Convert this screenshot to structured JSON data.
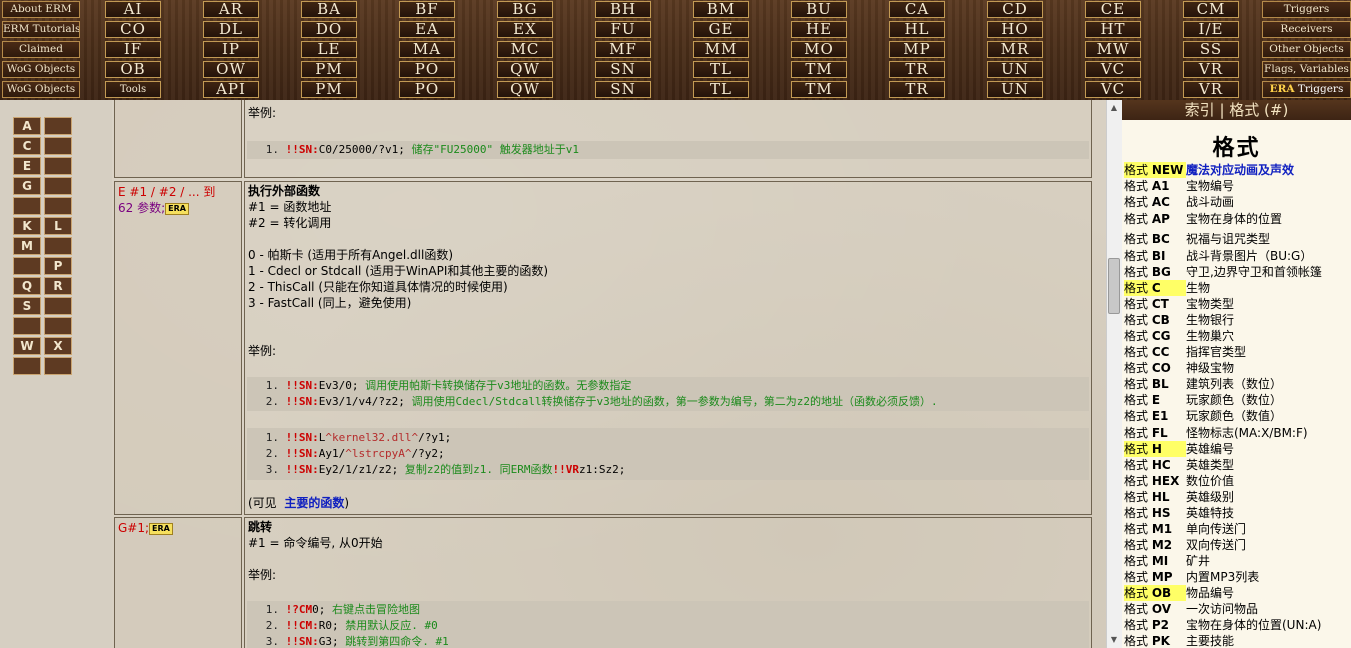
{
  "left_nav": [
    "About ERM",
    "ERM Tutorials",
    "Claimed",
    "WoG Objects",
    "WoG Objects"
  ],
  "right_nav": [
    "Triggers",
    "Receivers",
    "Other Objects",
    "Flags, Variables"
  ],
  "right_nav_era": {
    "prefix": "ERA",
    "label": "Triggers"
  },
  "grid_rows": [
    [
      "AI",
      "AR",
      "BA",
      "BF",
      "BG",
      "BH",
      "BM",
      "BU",
      "CA",
      "CD",
      "CE",
      "CM"
    ],
    [
      "CO",
      "DL",
      "DO",
      "EA",
      "EX",
      "FU",
      "GE",
      "HE",
      "HL",
      "HO",
      "HT",
      "I/E"
    ],
    [
      "IF",
      "IP",
      "LE",
      "MA",
      "MC",
      "MF",
      "MM",
      "MO",
      "MP",
      "MR",
      "MW",
      "SS"
    ],
    [
      "OB",
      "OW",
      "PM",
      "PO",
      "QW",
      "SN",
      "TL",
      "TM",
      "TR",
      "UN",
      "VC",
      "VR"
    ],
    [
      "Tools",
      "API",
      "PM",
      "PO",
      "QW",
      "SN",
      "TL",
      "TM",
      "TR",
      "UN",
      "VC",
      "VR"
    ]
  ],
  "alphabet": [
    [
      "A",
      ""
    ],
    [
      "C",
      ""
    ],
    [
      "E",
      ""
    ],
    [
      "G",
      ""
    ],
    [
      "",
      ""
    ],
    [
      "K",
      "L"
    ],
    [
      "M",
      ""
    ],
    [
      "",
      "P"
    ],
    [
      "Q",
      "R"
    ],
    [
      "S",
      ""
    ],
    [
      "",
      ""
    ],
    [
      "W",
      "X"
    ],
    [
      "",
      ""
    ]
  ],
  "content": {
    "row0": {
      "example_label": "举例:",
      "code": [
        {
          "n": "1.",
          "kw": "!!SN:",
          "rest": "C0/25000/?v1;",
          "cmt": " 储存\"FU25000\" 触发器地址于v1"
        }
      ]
    },
    "row1": {
      "syntax": "E #1 / #2 / ... 到 62 参数;",
      "syntax_a": "E #1 / #2 / ... 到",
      "syntax_b": "62 参数;",
      "badge": "ERA",
      "title": "执行外部函数",
      "lines": [
        "#1 = 函数地址",
        "#2 = 转化调用",
        "0 - 帕斯卡 (适用于所有Angel.dll函数)",
        "1 - Cdecl or Stdcall (适用于WinAPI和其他主要的函数)",
        "2 - ThisCall (只能在你知道具体情况的时候使用)",
        "3 - FastCall (同上，避免使用)"
      ],
      "example_label": "举例:",
      "code1": [
        {
          "n": "1.",
          "kw": "!!SN:",
          "rest": "Ev3/0;",
          "cmt": " 调用使用帕斯卡转换储存于v3地址的函数。无参数指定"
        },
        {
          "n": "2.",
          "kw": "!!SN:",
          "rest": "Ev3/1/v4/?z2;",
          "cmt": " 调用使用Cdecl/Stdcall转换储存于v3地址的函数，第一参数为编号，第二为z2的地址（函数必须反馈）."
        }
      ],
      "code2": [
        {
          "n": "1.",
          "kw": "!!SN:",
          "rest": "L",
          "str": "^kernel32.dll^",
          "tail": "/?y1;"
        },
        {
          "n": "2.",
          "kw": "!!SN:",
          "rest": "Ay1/",
          "str": "^lstrcpyA^",
          "tail": "/?y2;"
        },
        {
          "n": "3.",
          "kw": "!!SN:",
          "rest": "Ey2/1/z1/z2;",
          "cmt": " 复制z2的值到z1. 同ERM函数",
          "kw2": "!!VR",
          "tail": "z1:Sz2;"
        }
      ],
      "see_also_prefix": "(可见",
      "see_also_link": "主要的函数",
      "see_also_suffix": ")"
    },
    "row2": {
      "syntax": "G#1;",
      "badge": "ERA",
      "title": "跳转",
      "line": "#1 = 命令编号, 从0开始",
      "example_label": "举例:",
      "code": [
        {
          "n": "1.",
          "kw": "!?CM",
          "rest": "0;",
          "cmt": " 右键点击冒险地图"
        },
        {
          "n": "2.",
          "kw": "!!CM:",
          "rest": "R0;",
          "cmt": " 禁用默认反应. #0"
        },
        {
          "n": "3.",
          "kw": "!!SN:",
          "rest": "G3;",
          "cmt": " 跳转到第四命令. #1"
        }
      ]
    }
  },
  "right_pane": {
    "header": "索引  |  格式 (#)",
    "title": "格式",
    "items": [
      {
        "k": "格式",
        "c": "NEW",
        "d": "魔法对应动画及声效",
        "hl": true,
        "new": true
      },
      {
        "k": "格式",
        "c": "A1",
        "d": "宝物编号"
      },
      {
        "k": "格式",
        "c": "AC",
        "d": "战斗动画"
      },
      {
        "k": "格式",
        "c": "AP",
        "d": "宝物在身体的位置"
      },
      {
        "k": "格式",
        "c": "BC",
        "d": "祝福与诅咒类型"
      },
      {
        "k": "格式",
        "c": "BI",
        "d": "战斗背景图片（BU:G）"
      },
      {
        "k": "格式",
        "c": "BG",
        "d": "守卫,边界守卫和首领帐篷"
      },
      {
        "k": "格式",
        "c": "C",
        "d": "生物",
        "hl": true
      },
      {
        "k": "格式",
        "c": "CT",
        "d": "宝物类型"
      },
      {
        "k": "格式",
        "c": "CB",
        "d": "生物银行"
      },
      {
        "k": "格式",
        "c": "CG",
        "d": "生物巢穴"
      },
      {
        "k": "格式",
        "c": "CC",
        "d": "指挥官类型"
      },
      {
        "k": "格式",
        "c": "CO",
        "d": "神级宝物"
      },
      {
        "k": "格式",
        "c": "BL",
        "d": "建筑列表（数位）"
      },
      {
        "k": "格式",
        "c": "E",
        "d": "玩家颜色（数位）"
      },
      {
        "k": "格式",
        "c": "E1",
        "d": "玩家颜色（数值）"
      },
      {
        "k": "格式",
        "c": "FL",
        "d": "怪物标志(MA:X/BM:F)"
      },
      {
        "k": "格式",
        "c": "H",
        "d": "英雄编号",
        "hl": true
      },
      {
        "k": "格式",
        "c": "HC",
        "d": "英雄类型"
      },
      {
        "k": "格式",
        "c": "HEX",
        "d": "数位价值"
      },
      {
        "k": "格式",
        "c": "HL",
        "d": "英雄级别"
      },
      {
        "k": "格式",
        "c": "HS",
        "d": "英雄特技"
      },
      {
        "k": "格式",
        "c": "M1",
        "d": "单向传送门"
      },
      {
        "k": "格式",
        "c": "M2",
        "d": "双向传送门"
      },
      {
        "k": "格式",
        "c": "MI",
        "d": "矿井"
      },
      {
        "k": "格式",
        "c": "MP",
        "d": "内置MP3列表"
      },
      {
        "k": "格式",
        "c": "OB",
        "d": "物品编号",
        "hl": true
      },
      {
        "k": "格式",
        "c": "OV",
        "d": "一次访问物品"
      },
      {
        "k": "格式",
        "c": "P2",
        "d": "宝物在身体的位置(UN:A)"
      },
      {
        "k": "格式",
        "c": "PK",
        "d": "主要技能"
      }
    ]
  }
}
